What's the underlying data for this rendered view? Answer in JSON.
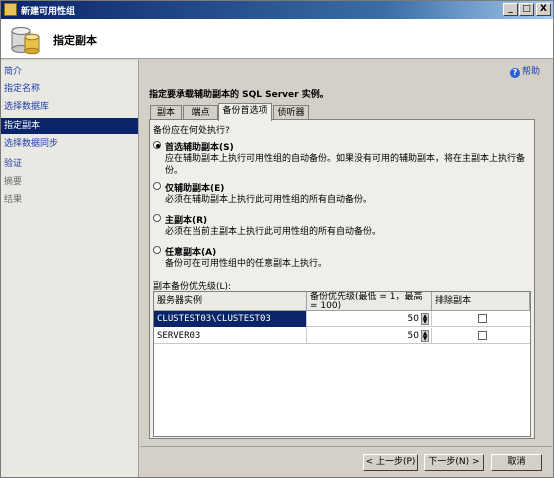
{
  "window": {
    "title": "新建可用性组",
    "minimize": "_",
    "maximize": "□",
    "close": "X"
  },
  "header": {
    "title": "指定副本"
  },
  "sidebar": {
    "items": [
      {
        "label": "简介"
      },
      {
        "label": "指定名称"
      },
      {
        "label": "选择数据库"
      },
      {
        "label": "指定副本"
      },
      {
        "label": "选择数据同步"
      },
      {
        "label": "验证"
      },
      {
        "label": "摘要"
      },
      {
        "label": "结果"
      }
    ]
  },
  "help": {
    "label": "帮助"
  },
  "instruction": "指定要承载辅助副本的 SQL Server 实例。",
  "tabs": [
    {
      "label": "副本"
    },
    {
      "label": "端点"
    },
    {
      "label": "备份首选项"
    },
    {
      "label": "侦听器"
    }
  ],
  "backup": {
    "question": "备份应在何处执行?",
    "options": [
      {
        "label": "首选辅助副本(S)",
        "desc": "应在辅助副本上执行可用性组的自动备份。如果没有可用的辅助副本，将在主副本上执行备份。",
        "selected": true
      },
      {
        "label": "仅辅助副本(E)",
        "desc": "必须在辅助副本上执行此可用性组的所有自动备份。",
        "selected": false
      },
      {
        "label": "主副本(R)",
        "desc": "必须在当前主副本上执行此可用性组的所有自动备份。",
        "selected": false
      },
      {
        "label": "任意副本(A)",
        "desc": "备份可在可用性组中的任意副本上执行。",
        "selected": false
      }
    ],
    "grid_label": "副本备份优先级(L):",
    "columns": [
      "服务器实例",
      "备份优先级(最低 = 1，最高 = 100)",
      "排除副本"
    ],
    "rows": [
      {
        "instance": "CLUSTEST03\\CLUSTEST03",
        "priority": "50",
        "exclude": false
      },
      {
        "instance": "SERVER03",
        "priority": "50",
        "exclude": false
      }
    ]
  },
  "footer": {
    "prev": "< 上一步(P)",
    "next": "下一步(N) >",
    "cancel": "取消"
  }
}
